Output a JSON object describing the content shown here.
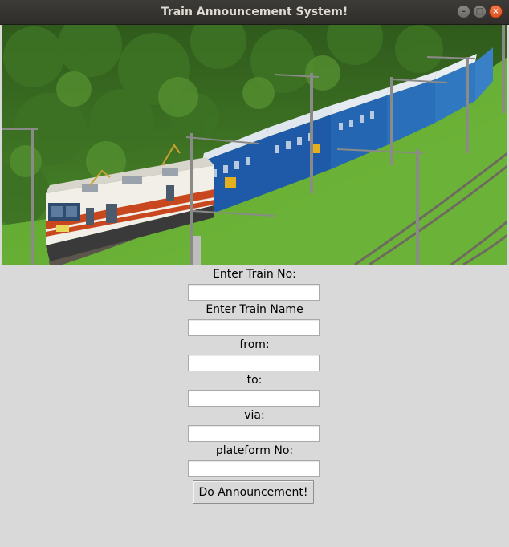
{
  "window": {
    "title": "Train Announcement System!",
    "controls": {
      "minimize": "–",
      "maximize": "□",
      "close": "×"
    }
  },
  "colors": {
    "background": "#d9d9d9",
    "titlebar": "#3c3b37",
    "close_button": "#e95420"
  },
  "form": {
    "fields": [
      {
        "label": "Enter Train No:",
        "value": ""
      },
      {
        "label": "Enter Train Name",
        "value": ""
      },
      {
        "label": "from:",
        "value": ""
      },
      {
        "label": "to:",
        "value": ""
      },
      {
        "label": "via:",
        "value": ""
      },
      {
        "label": "plateform No:",
        "value": ""
      }
    ],
    "submit_label": "Do Announcement!"
  }
}
